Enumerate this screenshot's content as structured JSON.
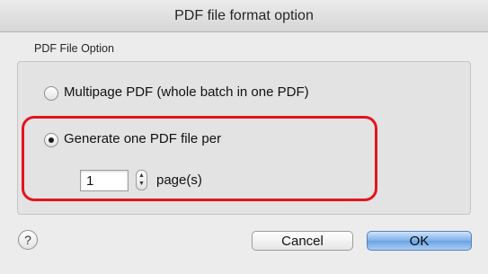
{
  "window": {
    "title": "PDF file format option"
  },
  "group": {
    "label": "PDF File Option"
  },
  "options": [
    {
      "label": "Multipage PDF (whole batch in one PDF)",
      "selected": false
    },
    {
      "label": "Generate one PDF file per",
      "selected": true
    }
  ],
  "pages": {
    "value": "1",
    "unit_label": "page(s)"
  },
  "stepper": {
    "up_icon": "▲",
    "down_icon": "▼"
  },
  "help": {
    "icon": "?"
  },
  "buttons": {
    "cancel": "Cancel",
    "ok": "OK"
  },
  "colors": {
    "highlight": "#e5141e",
    "default_button": "#7eb1ea"
  }
}
